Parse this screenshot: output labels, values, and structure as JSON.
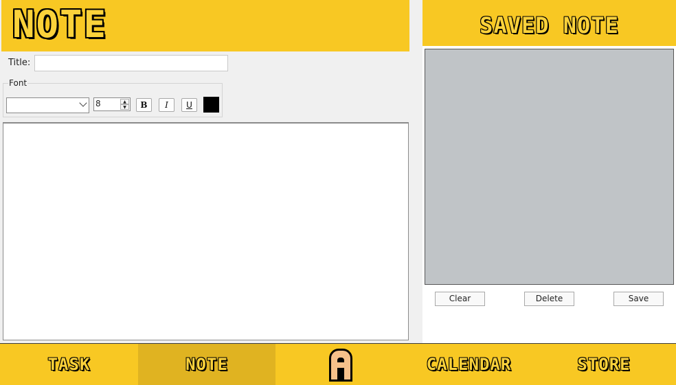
{
  "header": {
    "title": "NOTE"
  },
  "form": {
    "title_label": "Title:",
    "title_value": "",
    "font_group_label": "Font",
    "font_value": "",
    "font_size": "8",
    "bold_label": "B",
    "italic_label": "I",
    "underline_label": "U",
    "color": "#000000",
    "body_value": ""
  },
  "saved": {
    "title": "SAVED NOTE",
    "clear_label": "Clear",
    "delete_label": "Delete",
    "save_label": "Save"
  },
  "nav": {
    "task": "TASK",
    "note": "NOTE",
    "calendar": "CALENDAR",
    "store": "STORE",
    "logo_icon": "app-logo-a-icon"
  },
  "colors": {
    "accent_yellow": "#f8c823",
    "nav_active": "#e0b321",
    "list_bg": "#c0c4c7"
  }
}
